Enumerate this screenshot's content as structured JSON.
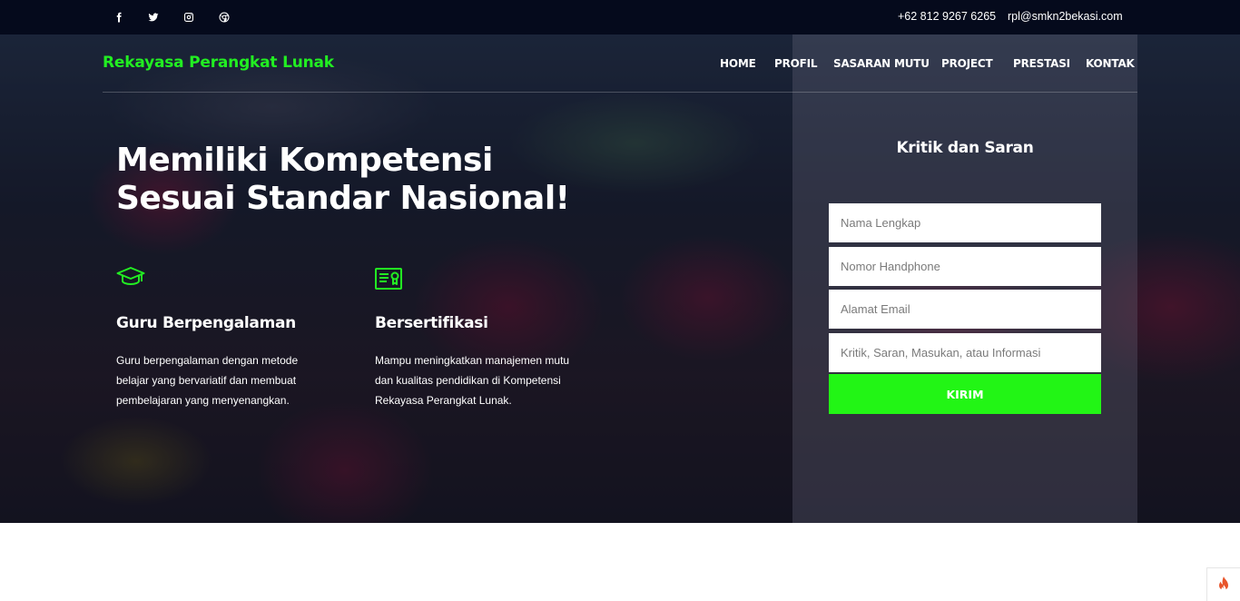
{
  "topbar": {
    "social": [
      {
        "name": "facebook-icon"
      },
      {
        "name": "twitter-icon"
      },
      {
        "name": "instagram-icon"
      },
      {
        "name": "chrome-icon"
      }
    ],
    "phone": "+62 812 9267 6265",
    "email": "rpl@smkn2bekasi.com"
  },
  "brand": "Rekayasa Perangkat Lunak",
  "nav": [
    "HOME",
    "PROFIL",
    "SASARAN MUTU",
    "PROJECT",
    "PRESTASI",
    "KONTAK"
  ],
  "hero": {
    "headline_line1": "Memiliki Kompetensi",
    "headline_line2": "Sesuai Standar Nasional!",
    "features": [
      {
        "icon": "graduation-cap-icon",
        "title": "Guru Berpengalaman",
        "desc_lines": [
          "Guru berpengalaman dengan metode",
          "belajar yang bervariatif dan membuat",
          "pembelajaran yang menyenangkan."
        ]
      },
      {
        "icon": "certificate-icon",
        "title": "Bersertifikasi",
        "desc_lines": [
          "Mampu meningkatkan manajemen mutu",
          "dan kualitas pendidikan di Kompetensi",
          "Rekayasa Perangkat Lunak."
        ]
      }
    ]
  },
  "form": {
    "title": "Kritik dan Saran",
    "name_placeholder": "Nama Lengkap",
    "phone_placeholder": "Nomor Handphone",
    "email_placeholder": "Alamat Email",
    "message_placeholder": "Kritik, Saran, Masukan, atau Informasi",
    "submit_label": "KIRIM"
  },
  "colors": {
    "accent": "#22f515",
    "brand": "#22ee22",
    "topbar": "#050a1c"
  },
  "corner_badge_icon": "flame-icon"
}
